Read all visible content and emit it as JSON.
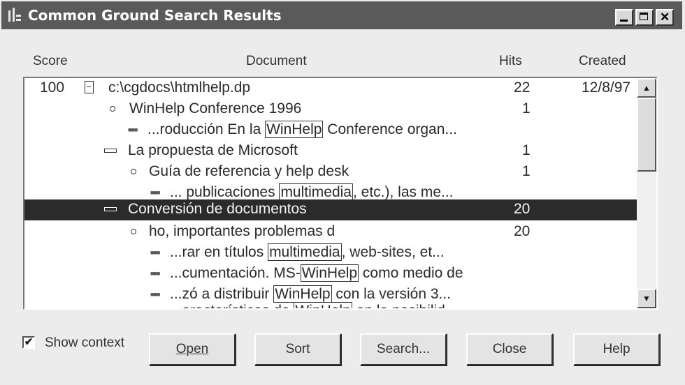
{
  "window": {
    "title": "Common Ground Search Results"
  },
  "columns": {
    "score": "Score",
    "document": "Document",
    "hits": "Hits",
    "created": "Created"
  },
  "rows": [
    {
      "score": "100",
      "label": "c:\\cgdocs\\htmlhelp.dp",
      "hits": "22",
      "created": "12/8/97"
    },
    {
      "label": "WinHelp Conference 1996",
      "hits": "1"
    },
    {
      "pre": "...roducción En la ",
      "hl": "WinHelp",
      "post": " Conference organ..."
    },
    {
      "label": "La propuesta de Microsoft",
      "hits": "1"
    },
    {
      "label": "Guía de referencia y help desk",
      "hits": "1"
    },
    {
      "pre": "... publicaciones ",
      "hl": "multimedia",
      "post": ", etc.), las me..."
    },
    {
      "label": "Conversión de documentos",
      "hits": "20",
      "selected": true
    },
    {
      "label": "ho, importantes problemas d",
      "hits": "20"
    },
    {
      "pre": "...rar en títulos ",
      "hl": "multimedia",
      "post": ", web-sites, et..."
    },
    {
      "pre": "...cumentación. MS-",
      "hl": "WinHelp",
      "post": " como medio de"
    },
    {
      "pre": "...zó a distribuir ",
      "hl": "WinHelp",
      "post": " con la versión 3..."
    },
    {
      "pre": "...aracterísticas de ",
      "hl": "WinHelp",
      "post": " en la posibilid..."
    }
  ],
  "context_dots": "■■■",
  "show_context": {
    "label": "Show context",
    "checked": true,
    "mark": "✔"
  },
  "buttons": {
    "open": "Open",
    "sort": "Sort",
    "search": "Search...",
    "close": "Close",
    "help": "Help"
  },
  "scroll": {
    "up": "▲",
    "down": "▼"
  }
}
